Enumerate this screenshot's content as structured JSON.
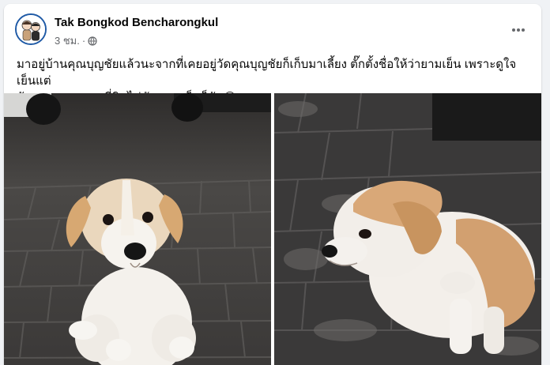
{
  "post": {
    "author": "Tak Bongkod Bencharongkul",
    "timestamp": "3 ชม.",
    "separator": "·",
    "privacy_icon": "globe-icon",
    "more_icon": "more-options-icon",
    "caption_line1": "มาอยู่บ้านคุณบุญชัยแล้วนะจากที่เคยอยู่วัดคุณบุญชัยก็เก็บมาเลี้ยง ตั๊กตั้งชื่อให้ว่ายามเย็น เพราะดูใจเย็นแต่",
    "caption_line2": "กัดงูแหลกเลย นกที่บินไม่ทัน ยามเย็นก็กัด😂"
  },
  "photos": [
    {
      "description_icon": "puppy-sitting-photo"
    },
    {
      "description_icon": "puppy-profile-photo"
    }
  ],
  "colors": {
    "background": "#f0f2f5",
    "card": "#ffffff",
    "text_primary": "#050505",
    "text_secondary": "#65676b",
    "avatar_ring": "#1f5aa6"
  }
}
